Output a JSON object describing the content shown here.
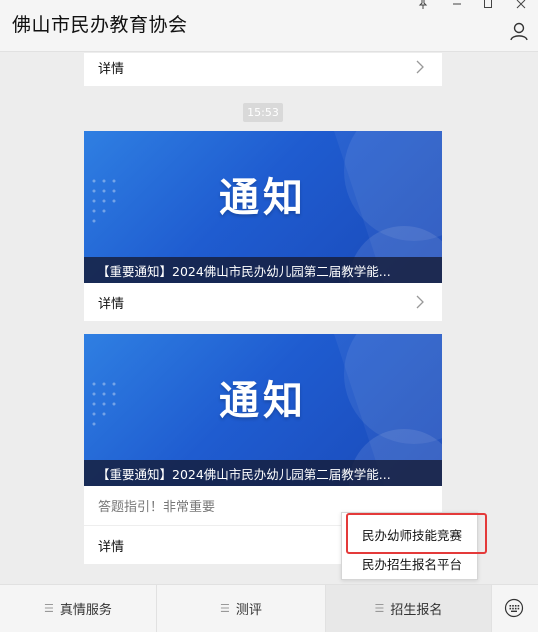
{
  "window": {
    "title": "佛山市民办教育协会"
  },
  "feed": {
    "top_detail_label": "详情",
    "time": "15:53",
    "articles": [
      {
        "banner_text": "通知",
        "caption": "【重要通知】2024佛山市民办幼儿园第二届教学能...",
        "detail_label": "详情"
      },
      {
        "banner_text": "通知",
        "caption": "【重要通知】2024佛山市民办幼儿园第二届教学能...",
        "tip": "答题指引！非常重要",
        "detail_label": "详情"
      }
    ]
  },
  "bottom_menu": {
    "tabs": [
      {
        "label": "真情服务"
      },
      {
        "label": "测评"
      },
      {
        "label": "招生报名"
      }
    ],
    "submenu": {
      "items": [
        {
          "label": "民办幼师技能竞赛"
        },
        {
          "label": "民办招生报名平台"
        }
      ]
    }
  },
  "colors": {
    "banner_blue": "#1f5cd0",
    "highlight_red": "#e43a3a"
  }
}
